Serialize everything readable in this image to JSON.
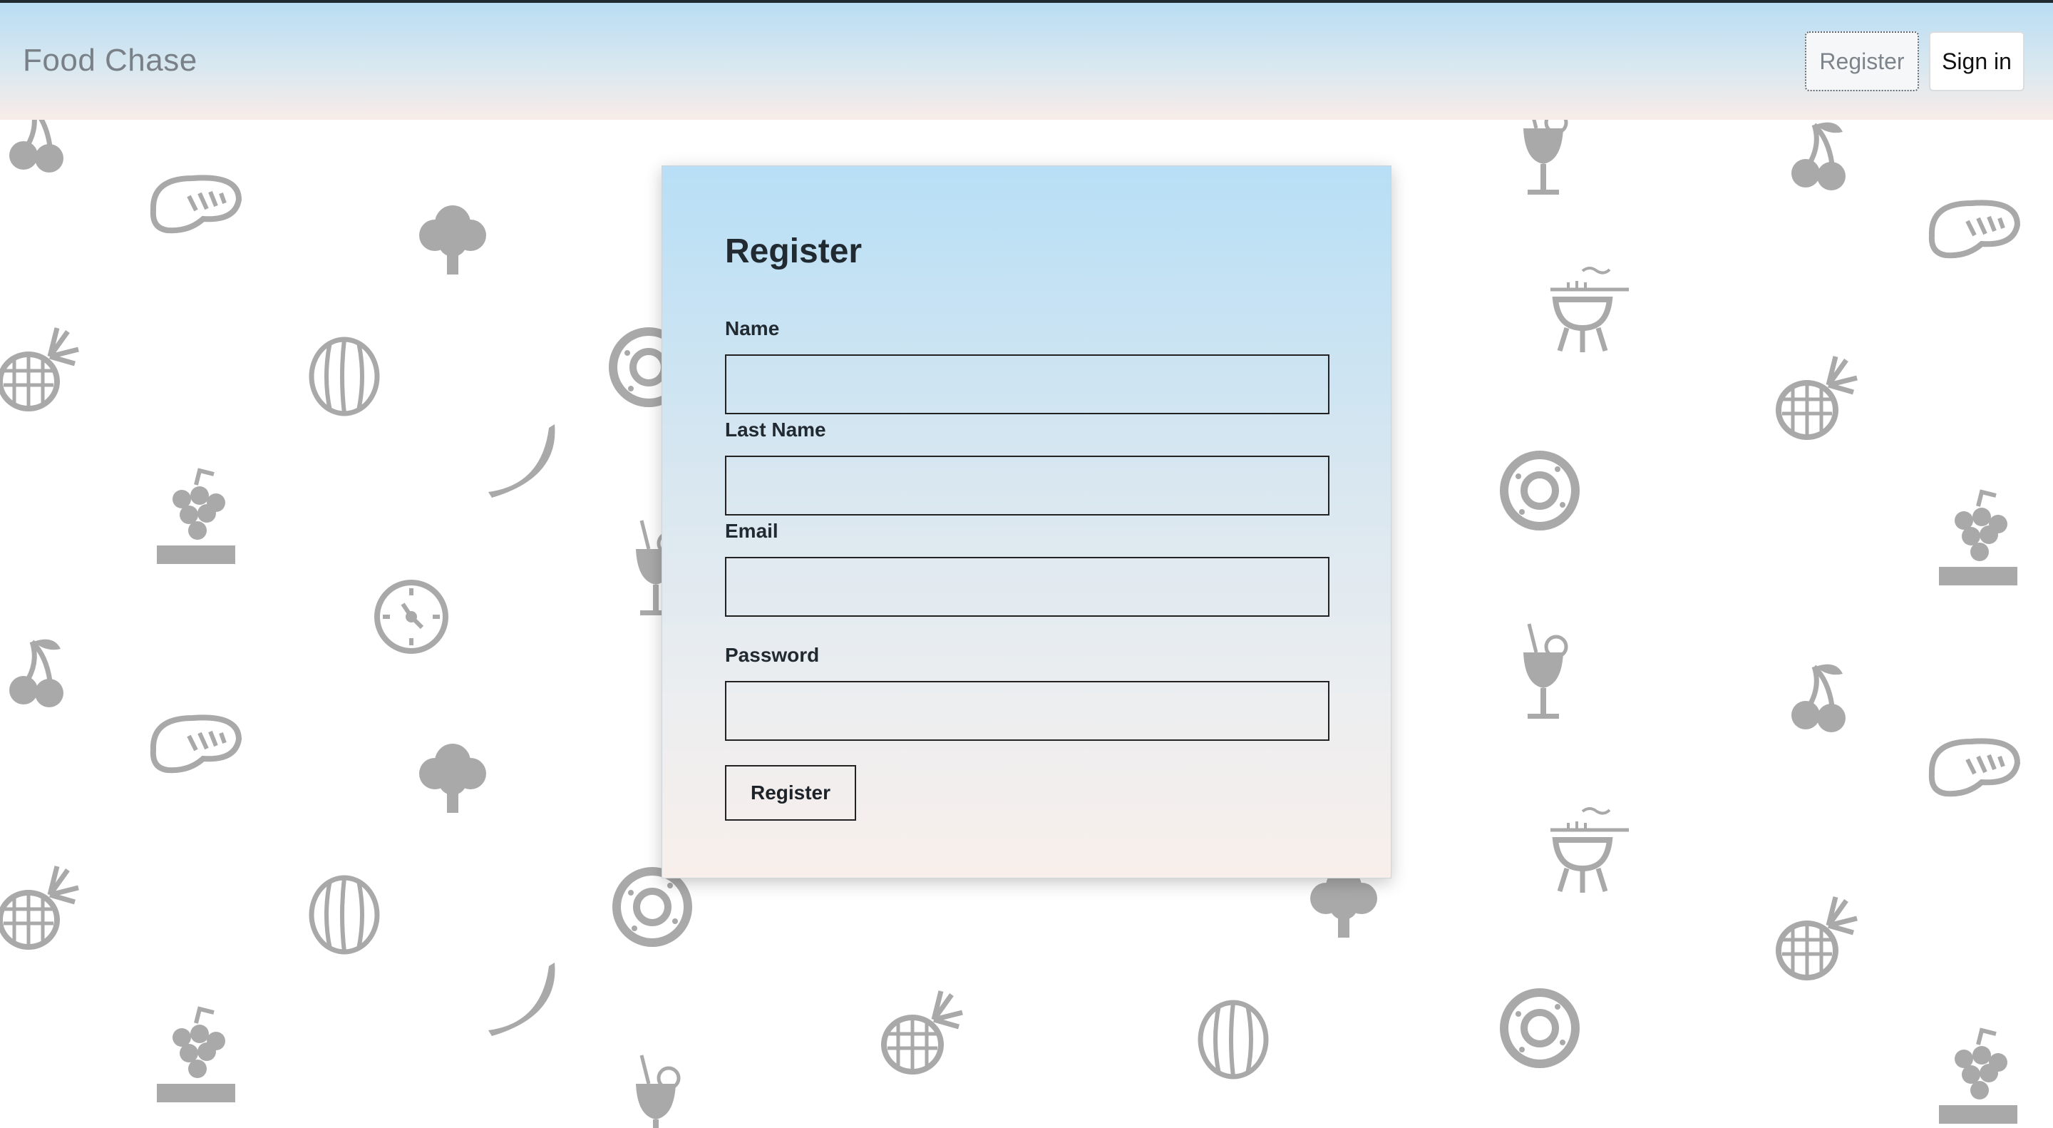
{
  "navbar": {
    "brand": "Food Chase",
    "register_label": "Register",
    "signin_label": "Sign in"
  },
  "form": {
    "title": "Register",
    "fields": [
      {
        "label": "Name",
        "value": "",
        "placeholder": ""
      },
      {
        "label": "Last Name",
        "value": "",
        "placeholder": ""
      },
      {
        "label": "Email",
        "value": "",
        "placeholder": ""
      },
      {
        "label": "Password",
        "value": "",
        "placeholder": ""
      }
    ],
    "submit_label": "Register"
  },
  "colors": {
    "icon_gray": "#a9a9a9",
    "nav_gradient_top": "#b9ddf3",
    "card_gradient_bottom": "#f8efeb"
  }
}
